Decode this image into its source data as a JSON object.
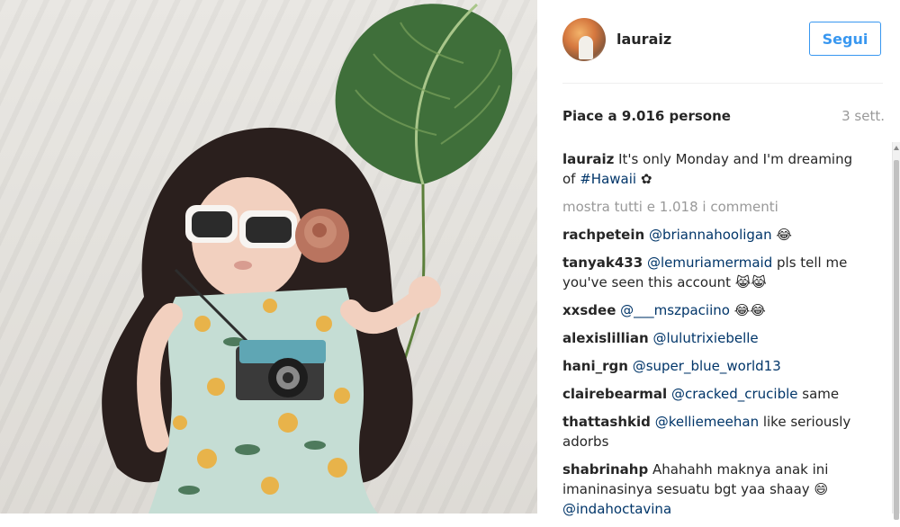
{
  "post": {
    "username": "lauraiz",
    "follow_label": "Segui",
    "likes": "Piace a 9.016 persone",
    "time": "3 sett.",
    "caption": {
      "user": "lauraiz",
      "text": "It's only Monday and I'm dreaming of ",
      "hashtag": "#Hawaii",
      "emoji": "✿"
    },
    "load_more": "mostra tutti e 1.018 i commenti",
    "comments": [
      {
        "user": "rachpetein",
        "mention": "@briannahooligan",
        "text": " 😂"
      },
      {
        "user": "tanyak433",
        "mention": "@lemuriamermaid",
        "text": " pls tell me you've seen this account 😹😹"
      },
      {
        "user": "xxsdee",
        "mention": "@___mszpaciino",
        "text": " 😂😂"
      },
      {
        "user": "alexislillian",
        "mention": "@lulutrixiebelle",
        "text": ""
      },
      {
        "user": "hani_rgn",
        "mention": "@super_blue_world13",
        "text": ""
      },
      {
        "user": "clairebearmal",
        "mention": "@cracked_crucible",
        "text": " same"
      },
      {
        "user": "thattashkid",
        "mention": "@kelliemeehan",
        "text": " like seriously adorbs"
      },
      {
        "user": "shabrinahp",
        "mention": "",
        "text": "Ahahahh maknya anak ini imaninasinya sesuatu bgt yaa shaay 😄"
      },
      {
        "user": "",
        "mention": "@indahoctavina",
        "text": ""
      }
    ]
  },
  "colors": {
    "accent": "#3897f0",
    "link": "#003569",
    "muted": "#999999"
  }
}
